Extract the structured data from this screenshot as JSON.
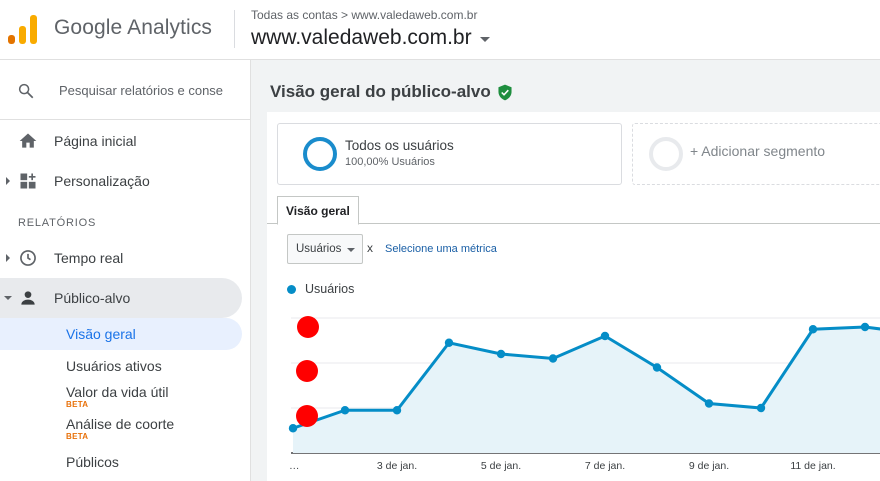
{
  "header": {
    "app_title": "Google Analytics",
    "breadcrumb": "Todas as contas > www.valedaweb.com.br",
    "property": "www.valedaweb.com.br"
  },
  "sidebar": {
    "search_placeholder": "Pesquisar relatórios e conse",
    "home": "Página inicial",
    "customization": "Personalização",
    "section_reports": "RELATÓRIOS",
    "realtime": "Tempo real",
    "audience": "Público-alvo",
    "audience_items": [
      {
        "label": "Visão geral",
        "selected": true
      },
      {
        "label": "Usuários ativos"
      },
      {
        "label": "Valor da vida útil",
        "badge": "BETA"
      },
      {
        "label": "Análise de coorte",
        "badge": "BETA"
      },
      {
        "label": "Públicos"
      }
    ]
  },
  "main": {
    "page_title": "Visão geral do público-alvo",
    "segments": {
      "all_name": "Todos os usuários",
      "all_pct": "100,00% Usuários",
      "add_label": "+ Adicionar segmento"
    },
    "tab": "Visão geral",
    "metric_selected": "Usuários",
    "vs_label": "x",
    "select_metric_link": "Selecione uma métrica"
  },
  "colors": {
    "line": "#058dc7",
    "area": "#e6f3f9",
    "marker": "#ff0000",
    "accent": "#1a73e8"
  },
  "chart_data": {
    "type": "area",
    "series": [
      {
        "name": "Usuários",
        "values": [
          11,
          19,
          19,
          49,
          44,
          42,
          52,
          38,
          22,
          20,
          55,
          56,
          53
        ]
      }
    ],
    "x_ticks": [
      "…",
      "3 de jan.",
      "5 de jan.",
      "7 de jan.",
      "9 de jan.",
      "11 de jan."
    ],
    "grid": true,
    "legend": "top-left"
  }
}
